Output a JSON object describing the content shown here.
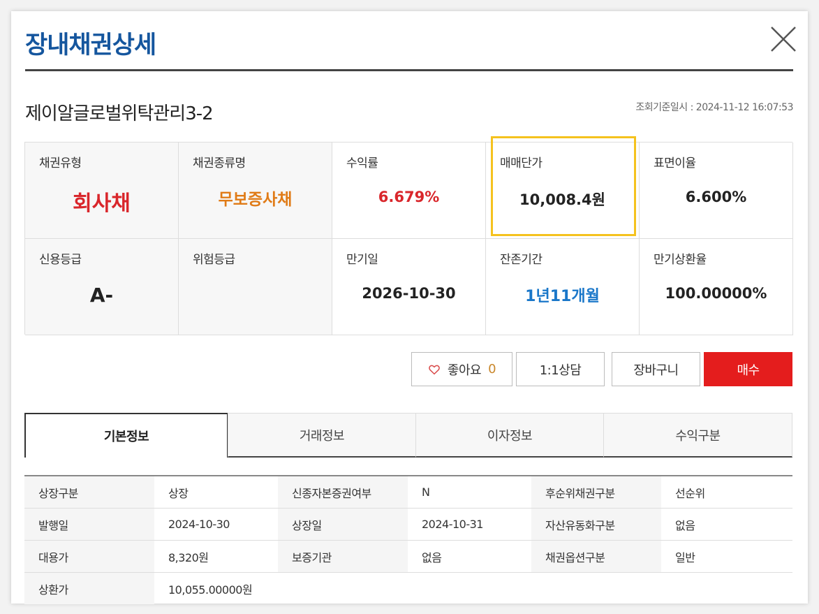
{
  "title": "장내채권상세",
  "bond_name": "제이알글로벌위탁관리3-2",
  "query_time": "조회기준일시 : 2024-11-12 16:07:53",
  "summary": [
    {
      "label": "채권유형",
      "value": "회사채",
      "color": "#d9262b"
    },
    {
      "label": "채권종류명",
      "value": "무보증사채",
      "color": "#e07b17"
    },
    {
      "label": "수익률",
      "value": "6.679%",
      "color": "#d9262b"
    },
    {
      "label": "매매단가",
      "value": "10,008.4원",
      "color": "#222222"
    },
    {
      "label": "표면이율",
      "value": "6.600%",
      "color": "#222222"
    },
    {
      "label": "신용등급",
      "value": "A-",
      "color": "#222222"
    },
    {
      "label": "위험등급",
      "value": "",
      "color": "#222222"
    },
    {
      "label": "만기일",
      "value": "2026-10-30",
      "color": "#222222"
    },
    {
      "label": "잔존기간",
      "value": "1년11개월",
      "color": "#1a77c9"
    },
    {
      "label": "만기상환율",
      "value": "100.00000%",
      "color": "#222222"
    }
  ],
  "buttons": {
    "like_label": "좋아요",
    "like_count": "0",
    "consult_label": "1:1상담",
    "cart_label": "장바구니",
    "buy_label": "매수"
  },
  "tabs": [
    "기본정보",
    "거래정보",
    "이자정보",
    "수익구분"
  ],
  "info_rows": [
    [
      {
        "label": "상장구분",
        "value": "상장"
      },
      {
        "label": "신종자본증권여부",
        "value": "N"
      },
      {
        "label": "후순위채권구분",
        "value": "선순위"
      }
    ],
    [
      {
        "label": "발행일",
        "value": "2024-10-30"
      },
      {
        "label": "상장일",
        "value": "2024-10-31"
      },
      {
        "label": "자산유동화구분",
        "value": "없음"
      }
    ],
    [
      {
        "label": "대용가",
        "value": "8,320원"
      },
      {
        "label": "보증기관",
        "value": "없음"
      },
      {
        "label": "채권옵션구분",
        "value": "일반"
      }
    ],
    [
      {
        "label": "상환가",
        "value": "10,055.00000원"
      }
    ]
  ],
  "colors": {
    "title": "#15569e",
    "buy_button": "#e41d1d",
    "highlight_border": "#f5c21e"
  }
}
